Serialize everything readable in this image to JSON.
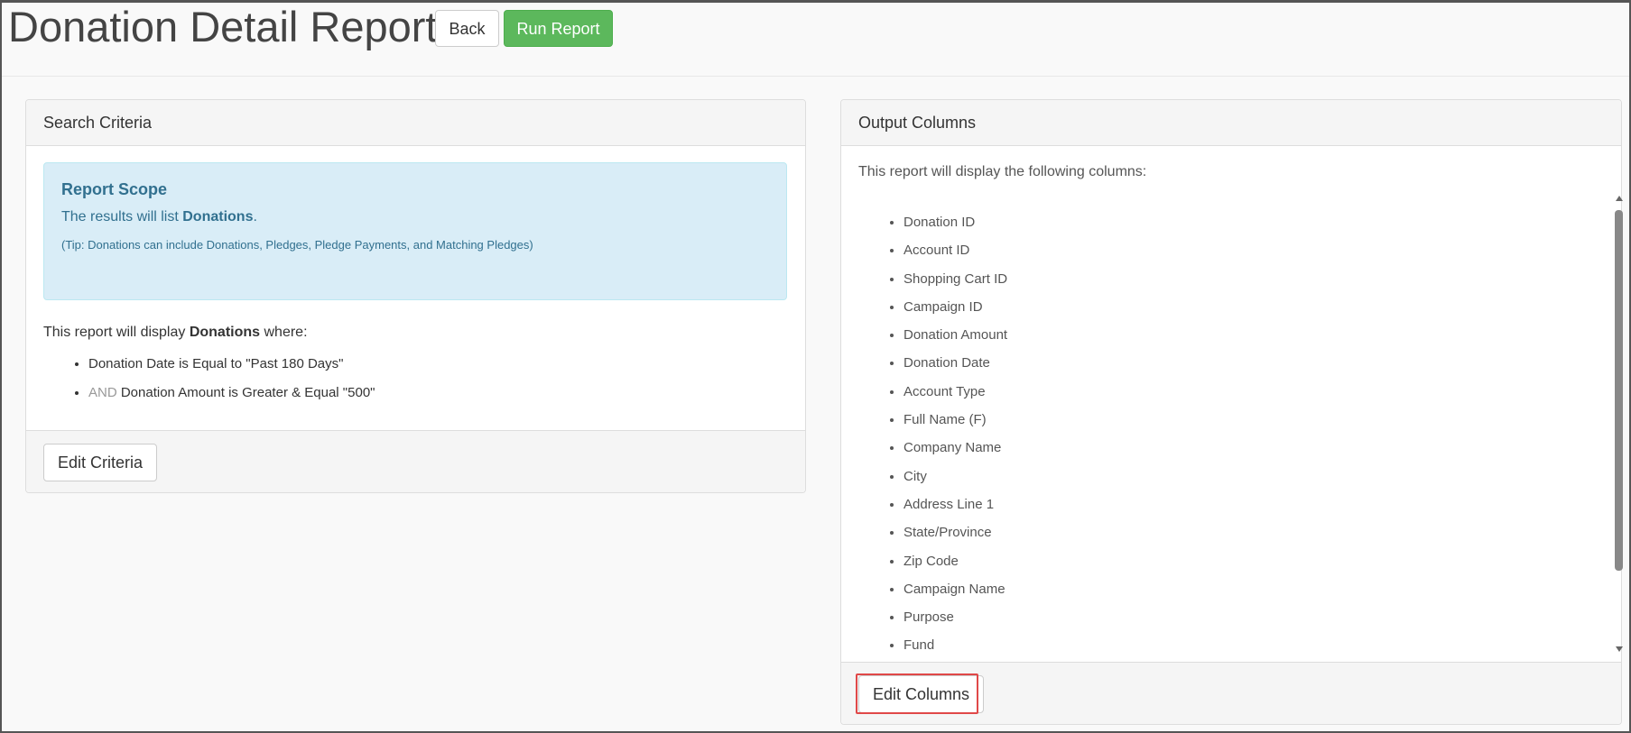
{
  "header": {
    "title": "Donation Detail Report",
    "back_label": "Back",
    "run_label": "Run Report"
  },
  "search_criteria": {
    "heading": "Search Criteria",
    "scope": {
      "title": "Report Scope",
      "line_prefix": "The results will list ",
      "line_entity": "Donations",
      "line_suffix": ".",
      "tip": "(Tip: Donations can include Donations, Pledges, Pledge Payments, and Matching Pledges)"
    },
    "intro_prefix": "This report will display ",
    "intro_entity": "Donations",
    "intro_suffix": " where:",
    "criteria": [
      {
        "connector": "",
        "text": "Donation Date is Equal to \"Past 180 Days\""
      },
      {
        "connector": "AND",
        "text": " Donation Amount is Greater & Equal \"500\""
      }
    ],
    "edit_label": "Edit Criteria"
  },
  "output_columns": {
    "heading": "Output Columns",
    "intro": "This report will display the following columns:",
    "columns": [
      "Donation ID",
      "Account ID",
      "Shopping Cart ID",
      "Campaign ID",
      "Donation Amount",
      "Donation Date",
      "Account Type",
      "Full Name (F)",
      "Company Name",
      "City",
      "Address Line 1",
      "State/Province",
      "Zip Code",
      "Campaign Name",
      "Purpose",
      "Fund"
    ],
    "edit_label": "Edit Columns"
  },
  "colors": {
    "run_button": "#5cb85c",
    "info_box": "#d9edf7",
    "info_text": "#31708f",
    "highlight": "#e04848"
  }
}
